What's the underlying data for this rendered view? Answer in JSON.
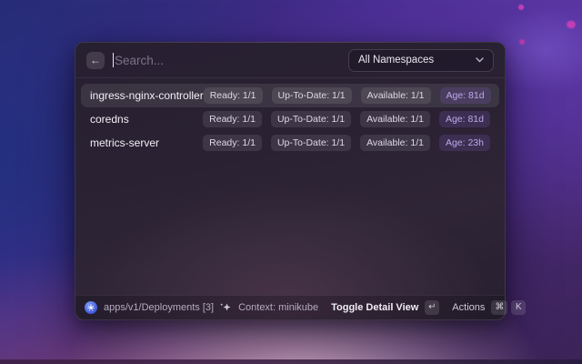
{
  "header": {
    "back_icon": "←",
    "search": {
      "placeholder": "Search...",
      "value": ""
    },
    "namespace_dropdown": {
      "value": "All Namespaces"
    }
  },
  "list": {
    "rows": [
      {
        "name": "ingress-nginx-controller",
        "selected": true,
        "badges": [
          "Ready: 1/1",
          "Up-To-Date: 1/1",
          "Available: 1/1",
          "Age: 81d"
        ]
      },
      {
        "name": "coredns",
        "selected": false,
        "badges": [
          "Ready: 1/1",
          "Up-To-Date: 1/1",
          "Available: 1/1",
          "Age: 81d"
        ]
      },
      {
        "name": "metrics-server",
        "selected": false,
        "badges": [
          "Ready: 1/1",
          "Up-To-Date: 1/1",
          "Available: 1/1",
          "Age: 23h"
        ]
      }
    ]
  },
  "footer": {
    "source": "apps/v1/Deployments [3]",
    "context": "Context: minikube",
    "primary_action": {
      "label": "Toggle Detail View",
      "key": "↵"
    },
    "actions": {
      "label": "Actions",
      "keys": [
        "⌘",
        "K"
      ]
    }
  },
  "colors": {
    "kubernetes_blue": "#3c59d9",
    "age_badge_text": "#bda7ea",
    "desktop_purple": "#4f2f97",
    "desktop_pink_glow": "#d9b0c9"
  }
}
